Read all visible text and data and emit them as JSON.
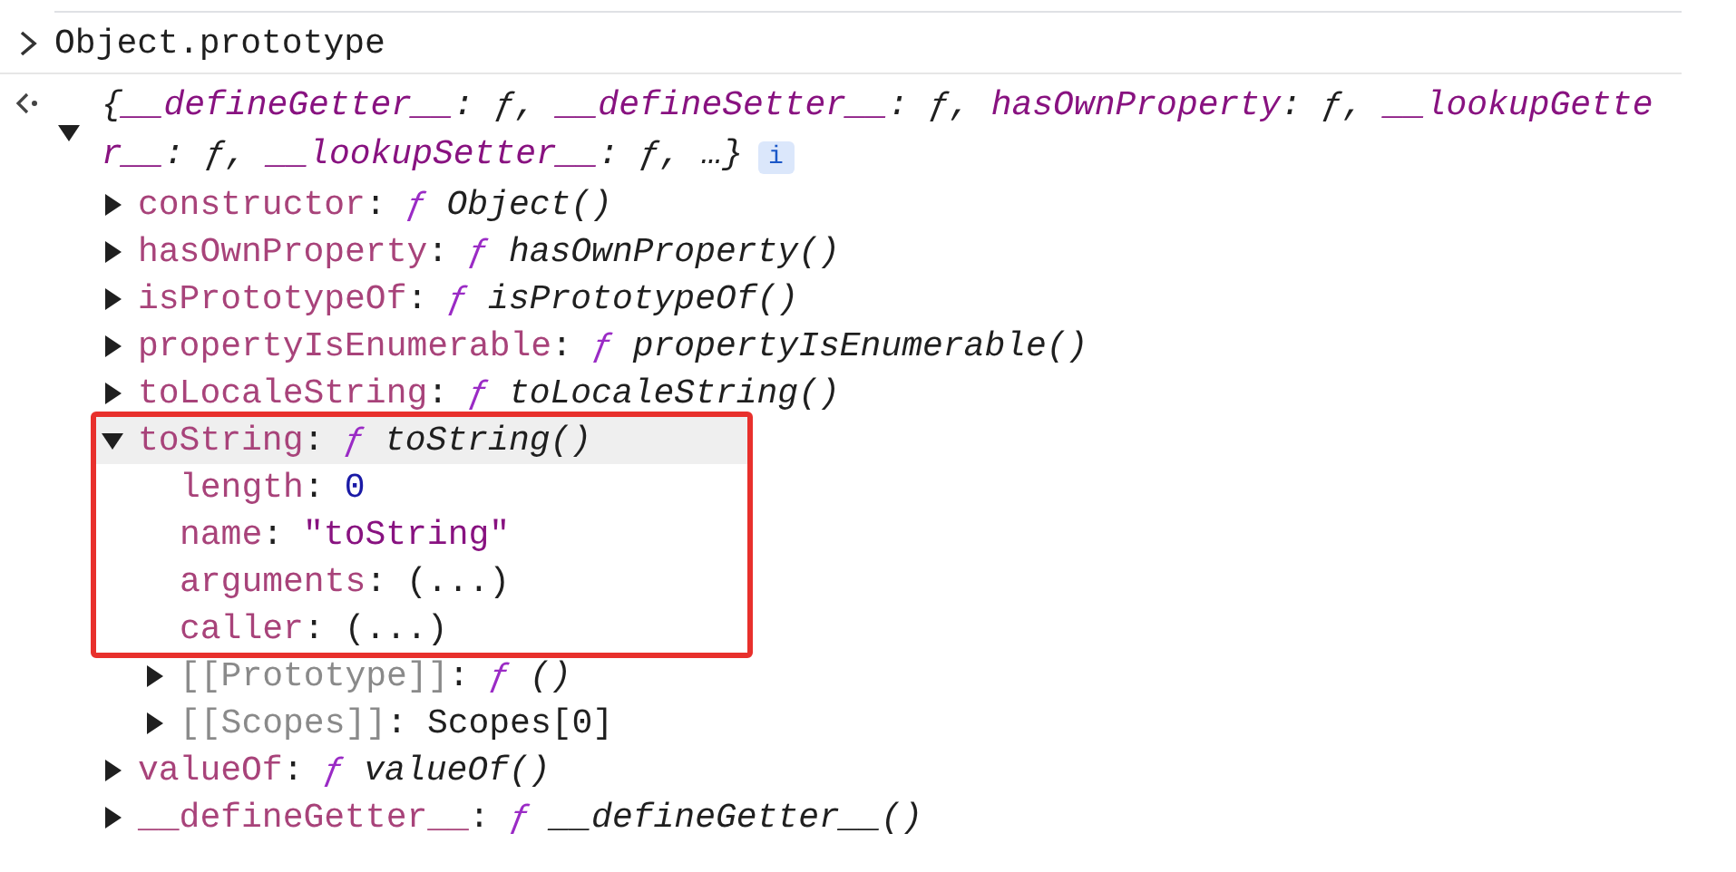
{
  "input": {
    "text": "Object.prototype"
  },
  "result": {
    "expanded": true,
    "open": "{",
    "summary": [
      {
        "key": "__defineGetter__",
        "separator": ":",
        "value": "ƒ,"
      },
      {
        "key": "__defineSetter__",
        "separator": ":",
        "value": "ƒ,"
      },
      {
        "key": "hasOwnProperty",
        "separator": ":",
        "value": "ƒ,"
      },
      {
        "key": "__lookupGetter__",
        "separator": ":",
        "value": "ƒ,"
      },
      {
        "key": "__lookupSetter__",
        "separator": ":",
        "value": "ƒ,"
      }
    ],
    "summary_more": "…}",
    "info_badge": "i",
    "properties": [
      {
        "key": "constructor",
        "separator": ":",
        "internal": false,
        "kind": "function",
        "sign": "ƒ",
        "value": "Object()",
        "expanded": false,
        "selected": false,
        "framed": false
      },
      {
        "key": "hasOwnProperty",
        "separator": ":",
        "internal": false,
        "kind": "function",
        "sign": "ƒ",
        "value": "hasOwnProperty()",
        "expanded": false,
        "selected": false,
        "framed": false
      },
      {
        "key": "isPrototypeOf",
        "separator": ":",
        "internal": false,
        "kind": "function",
        "sign": "ƒ",
        "value": "isPrototypeOf()",
        "expanded": false,
        "selected": false,
        "framed": false
      },
      {
        "key": "propertyIsEnumerable",
        "separator": ":",
        "internal": false,
        "kind": "function",
        "sign": "ƒ",
        "value": "propertyIsEnumerable()",
        "expanded": false,
        "selected": false,
        "framed": false
      },
      {
        "key": "toLocaleString",
        "separator": ":",
        "internal": false,
        "kind": "function",
        "sign": "ƒ",
        "value": "toLocaleString()",
        "expanded": false,
        "selected": false,
        "framed": false
      },
      {
        "key": "toString",
        "separator": ":",
        "internal": false,
        "kind": "function",
        "sign": "ƒ",
        "value": "toString()",
        "expanded": true,
        "selected": true,
        "framed": true,
        "children": [
          {
            "key": "length",
            "separator": ":",
            "internal": false,
            "kind": "number",
            "value": "0",
            "selected": false,
            "framed": true
          },
          {
            "key": "name",
            "separator": ":",
            "internal": false,
            "kind": "string",
            "value": "\"toString\"",
            "selected": false,
            "framed": true
          },
          {
            "key": "arguments",
            "separator": ":",
            "internal": false,
            "kind": "plain",
            "value": "(...)",
            "selected": false,
            "framed": true
          },
          {
            "key": "caller",
            "separator": ":",
            "internal": false,
            "kind": "plain",
            "value": "(...)",
            "selected": false,
            "framed": true
          },
          {
            "key": "[[Prototype]]",
            "separator": ":",
            "internal": true,
            "kind": "function",
            "sign": "ƒ",
            "value": "()",
            "expanded": false,
            "selected": false,
            "framed": false
          },
          {
            "key": "[[Scopes]]",
            "separator": ":",
            "internal": true,
            "kind": "plain",
            "value": "Scopes[0]",
            "expanded": false,
            "selected": false,
            "framed": false
          }
        ]
      },
      {
        "key": "valueOf",
        "separator": ":",
        "internal": false,
        "kind": "function",
        "sign": "ƒ",
        "value": "valueOf()",
        "expanded": false,
        "selected": false,
        "framed": false
      },
      {
        "key": "__defineGetter__",
        "separator": ":",
        "internal": false,
        "kind": "function",
        "sign": "ƒ",
        "value": "__defineGetter__()",
        "expanded": false,
        "selected": false,
        "framed": false
      }
    ]
  }
}
